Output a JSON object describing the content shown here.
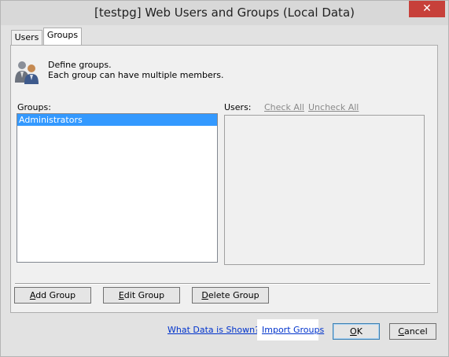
{
  "window": {
    "title": "[testpg] Web Users and Groups (Local Data)",
    "close_symbol": "✕"
  },
  "tabs": [
    {
      "label": "Users",
      "active": false
    },
    {
      "label": "Groups",
      "active": true
    }
  ],
  "description": {
    "icon": "users-group-icon",
    "line1": "Define groups.",
    "line2": "Each group can have multiple members."
  },
  "groups": {
    "label": "Groups:",
    "items": [
      {
        "label": "Administrators",
        "selected": true
      }
    ]
  },
  "users": {
    "label": "Users:",
    "check_all": "Check All",
    "uncheck_all": "Uncheck All",
    "items": []
  },
  "actions": {
    "add_group_u": "A",
    "add_group_rest": "dd Group",
    "edit_group_u": "E",
    "edit_group_rest": "dit Group",
    "delete_group_u": "D",
    "delete_group_rest": "elete Group"
  },
  "footer": {
    "what_data_link": "What Data is Shown?",
    "import_groups_link": "Import Groups",
    "ok_u": "O",
    "ok_rest": "K",
    "cancel_u": "C",
    "cancel_rest": "ancel"
  },
  "colors": {
    "selection": "#3399ff",
    "link": "#0033cc",
    "close_button": "#c7403a"
  }
}
